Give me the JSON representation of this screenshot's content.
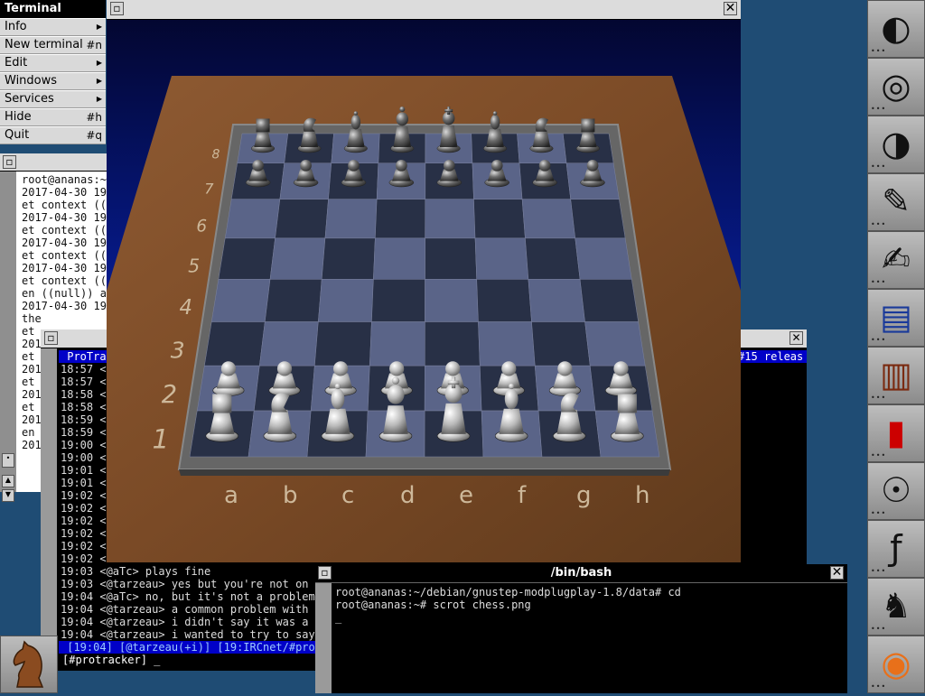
{
  "menu": {
    "title": "Terminal",
    "items": [
      {
        "label": "Info",
        "key": "",
        "sub": true
      },
      {
        "label": "New terminal",
        "key": "#n",
        "sub": false
      },
      {
        "label": "Edit",
        "key": "",
        "sub": true
      },
      {
        "label": "Windows",
        "key": "",
        "sub": true
      },
      {
        "label": "Services",
        "key": "",
        "sub": true
      },
      {
        "label": "Hide",
        "key": "#h",
        "sub": false
      },
      {
        "label": "Quit",
        "key": "#q",
        "sub": false
      }
    ]
  },
  "log_terminal": {
    "lines": [
      "root@ananas:~/",
      "2017-04-30 19:",
      "et context ((n",
      "2017-04-30 19:",
      "et context ((n",
      "2017-04-30 19:",
      "et context ((n",
      "2017-04-30 19:",
      "et context ((n",
      "en ((null)) a",
      "2017-04-30 19:",
      "the",
      "et",
      "201",
      "et",
      "201",
      "et",
      "201",
      "et",
      "201",
      "en",
      "201"
    ]
  },
  "irc": {
    "header_left": " ProTrac",
    "header_right": "#15 releas",
    "lines": [
      "18:57 <",
      "18:57 <",
      "18:58 <",
      "18:58 <",
      "18:59 <",
      "18:59 <",
      "19:00 <",
      "19:00 <",
      "19:01 <",
      "19:01 <",
      "19:02 <",
      "19:02 <",
      "19:02 <",
      "19:02 <",
      "19:02 <",
      "19:02 <",
      "19:03 <@aTc> plays fine",
      "19:03 <@tarzeau> yes but you're not on p",
      "19:04 <@aTc> no, but it's not a problem",
      "19:04 <@tarzeau> a common problem with a",
      "19:04 <@tarzeau> i didn't say it was a p",
      "19:04 <@tarzeau> i wanted to try to say"
    ],
    "status": " [19:04] [@tarzeau(+i)] [19:IRCnet/#prot",
    "prompt": "[#protracker] _"
  },
  "bash": {
    "title": "/bin/bash",
    "lines": [
      "root@ananas:~/debian/gnustep-modplugplay-1.8/data# cd",
      "root@ananas:~# scrot chess.png",
      "_"
    ]
  },
  "chess": {
    "ranks": [
      "8",
      "7",
      "6",
      "5",
      "4",
      "3",
      "2",
      "1"
    ],
    "files": [
      "a",
      "b",
      "c",
      "d",
      "e",
      "f",
      "g",
      "h"
    ],
    "back_rank": [
      "rook",
      "knight",
      "bishop",
      "queen",
      "king",
      "bishop",
      "knight",
      "rook"
    ]
  },
  "dock_icons": [
    "gnustep-logo-icon",
    "disk-usage-icon",
    "gnustep-app-icon",
    "preferences-tools-icon",
    "text-editor-icon",
    "gnu-terminal-icon",
    "dictionary-book-icon",
    "mail-postbox-icon",
    "network-dish-icon",
    "font-manager-icon",
    "chess-piece-small-icon",
    "firefox-icon"
  ],
  "colors": {
    "desktop": "#1f4c74",
    "title_active": "#000000",
    "title_inactive": "#dadada",
    "irc_status": "#0000c8"
  }
}
